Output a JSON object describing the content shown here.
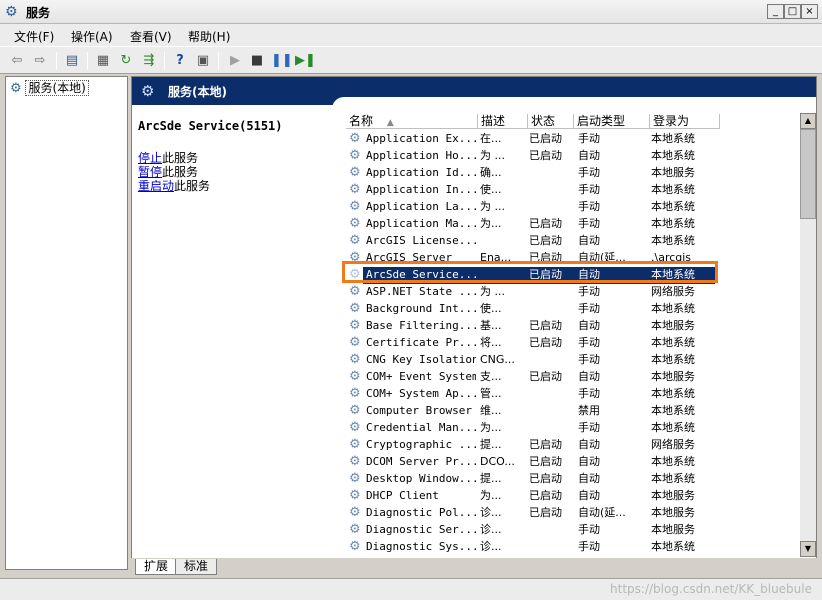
{
  "window": {
    "title": "服务"
  },
  "menu": [
    "文件(F)",
    "操作(A)",
    "查看(V)",
    "帮助(H)"
  ],
  "nav": {
    "root": "服务(本地)"
  },
  "main": {
    "header": "服务(本地)",
    "selected_service": "ArcSde Service(5151)",
    "actions": [
      {
        "link": "停止",
        "rest": "此服务"
      },
      {
        "link": "暂停",
        "rest": "此服务"
      },
      {
        "link": "重启动",
        "rest": "此服务"
      }
    ]
  },
  "columns": [
    "名称",
    "描述",
    "状态",
    "启动类型",
    "登录为"
  ],
  "rows": [
    [
      "Application Ex...",
      "在...",
      "已启动",
      "手动",
      "本地系统"
    ],
    [
      "Application Ho...",
      "为 ...",
      "已启动",
      "自动",
      "本地系统"
    ],
    [
      "Application Id...",
      "确...",
      "",
      "手动",
      "本地服务"
    ],
    [
      "Application In...",
      "使...",
      "",
      "手动",
      "本地系统"
    ],
    [
      "Application La...",
      "为 ...",
      "",
      "手动",
      "本地系统"
    ],
    [
      "Application Ma...",
      "为...",
      "已启动",
      "手动",
      "本地系统"
    ],
    [
      "ArcGIS License...",
      "",
      "已启动",
      "自动",
      "本地系统"
    ],
    [
      "ArcGIS Server",
      "Ena...",
      "已启动",
      "自动(延...",
      ".\\arcgis"
    ],
    [
      "ArcSde Service...",
      "",
      "已启动",
      "自动",
      "本地系统"
    ],
    [
      "ASP.NET State ...",
      "为 ...",
      "",
      "手动",
      "网络服务"
    ],
    [
      "Background Int...",
      "使...",
      "",
      "手动",
      "本地系统"
    ],
    [
      "Base Filtering...",
      "基...",
      "已启动",
      "自动",
      "本地服务"
    ],
    [
      "Certificate Pr...",
      "将...",
      "已启动",
      "手动",
      "本地系统"
    ],
    [
      "CNG Key Isolation",
      "CNG...",
      "",
      "手动",
      "本地系统"
    ],
    [
      "COM+ Event System",
      "支...",
      "已启动",
      "自动",
      "本地服务"
    ],
    [
      "COM+ System Ap...",
      "管...",
      "",
      "手动",
      "本地系统"
    ],
    [
      "Computer Browser",
      "维...",
      "",
      "禁用",
      "本地系统"
    ],
    [
      "Credential Man...",
      "为...",
      "",
      "手动",
      "本地系统"
    ],
    [
      "Cryptographic ...",
      "提...",
      "已启动",
      "自动",
      "网络服务"
    ],
    [
      "DCOM Server Pr...",
      "DCO...",
      "已启动",
      "自动",
      "本地系统"
    ],
    [
      "Desktop Window...",
      "提...",
      "已启动",
      "自动",
      "本地系统"
    ],
    [
      "DHCP Client",
      "为...",
      "已启动",
      "自动",
      "本地服务"
    ],
    [
      "Diagnostic Pol...",
      "诊...",
      "已启动",
      "自动(延...",
      "本地服务"
    ],
    [
      "Diagnostic Ser...",
      "诊...",
      "",
      "手动",
      "本地服务"
    ],
    [
      "Diagnostic Sys...",
      "诊...",
      "",
      "手动",
      "本地系统"
    ]
  ],
  "selected_row": 8,
  "tabs": [
    "扩展",
    "标准"
  ],
  "watermark": "https://blog.csdn.net/KK_bluebule"
}
